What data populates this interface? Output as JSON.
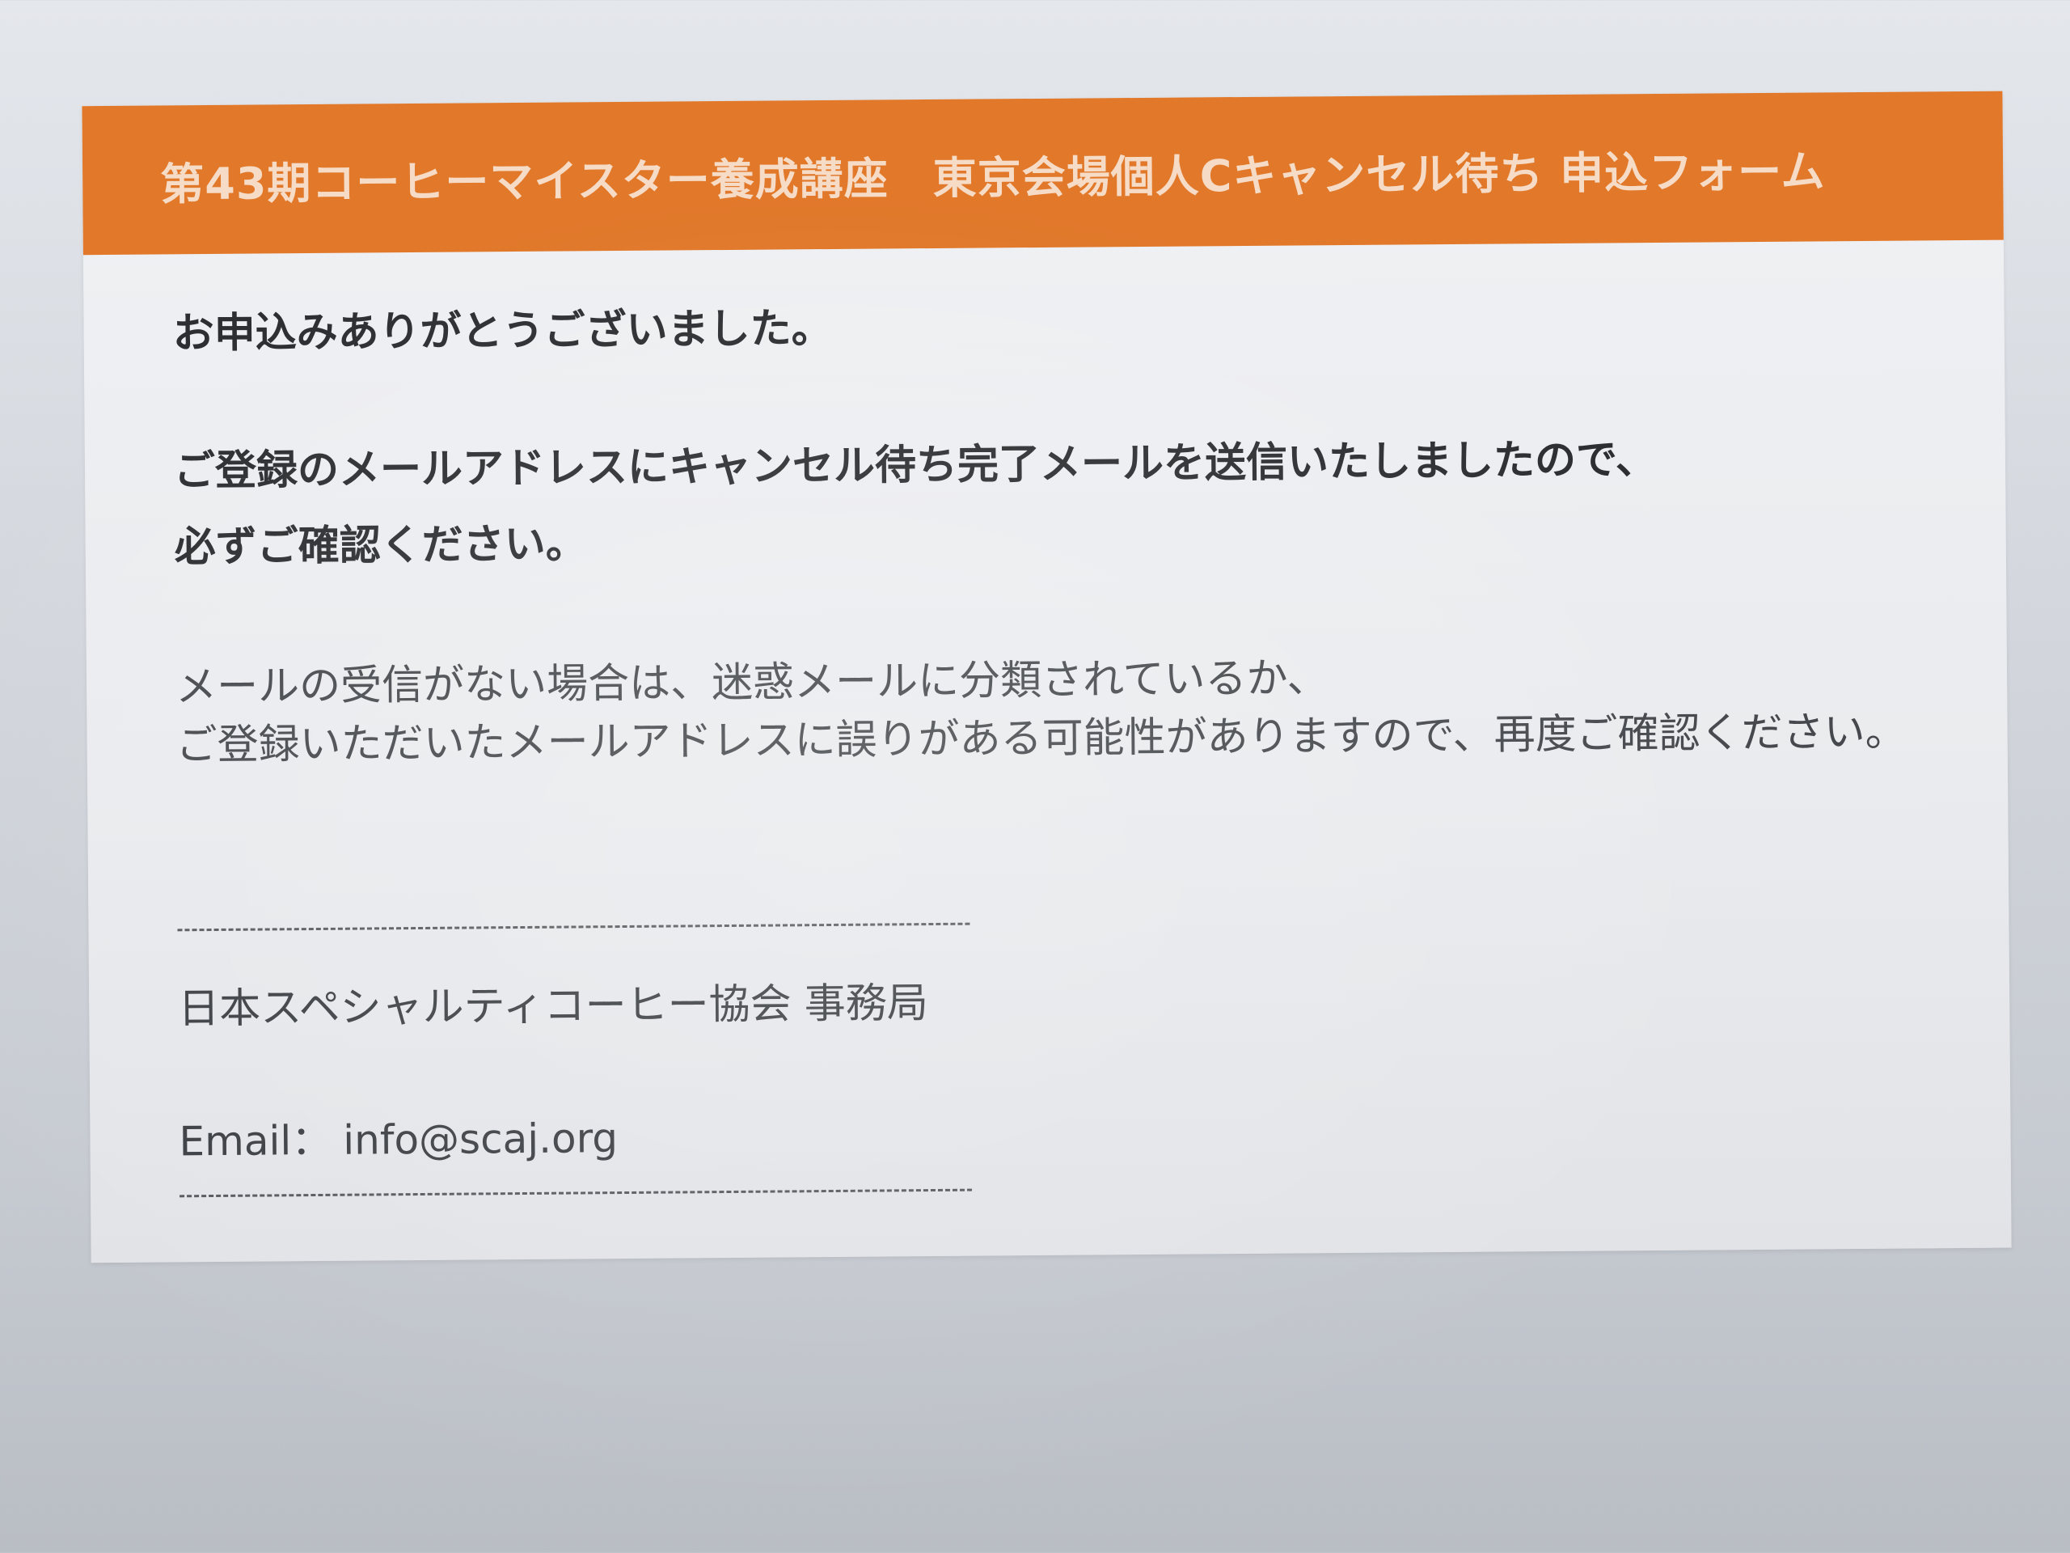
{
  "form": {
    "title": "第43期コーヒーマイスター養成講座　東京会場個人Cキャンセル待ち 申込フォーム",
    "thanks": "お申込みありがとうございました。",
    "notice_lines": [
      "ご登録のメールアドレスにキャンセル待ち完了メールを送信いたしましたので、",
      "必ずご確認ください。"
    ],
    "advice_lines": [
      "メールの受信がない場合は、迷惑メールに分類されているか、",
      "ご登録いただいたメールアドレスに誤りがある可能性がありますので、再度ご確認ください。"
    ],
    "footer": {
      "organization": "日本スペシャルティコーヒー協会 事務局",
      "email_label": "Email：",
      "email_address": "info@scaj.org"
    }
  },
  "colors": {
    "header": "#e1782a",
    "header_text": "#f6dcc6",
    "body_text": "#2c2e31",
    "card": "#eceef1",
    "background": "#cfd3d9"
  }
}
